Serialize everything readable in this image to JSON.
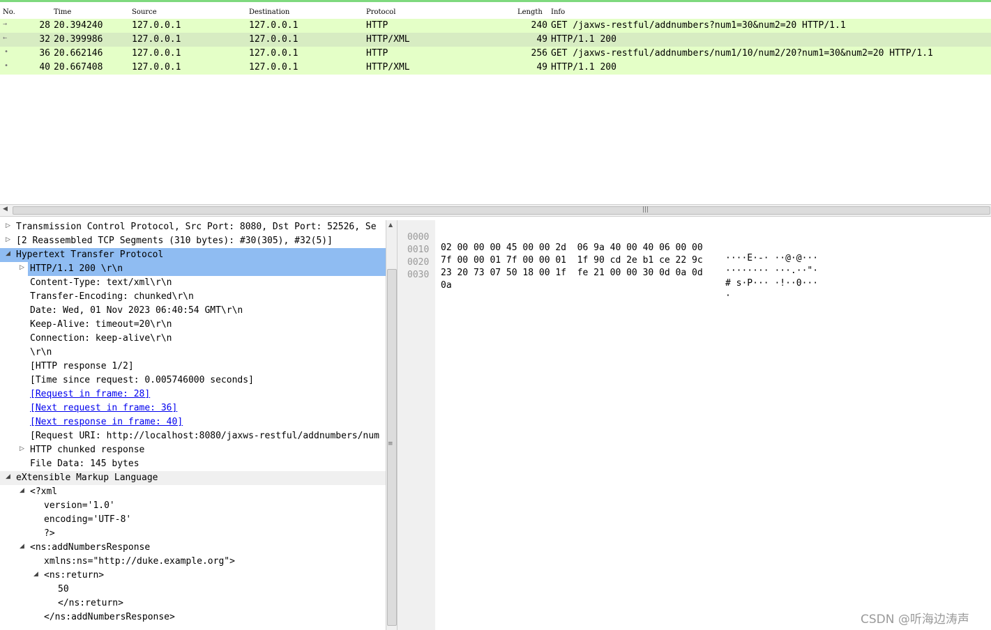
{
  "packet_list": {
    "columns": [
      "No.",
      "Time",
      "Source",
      "Destination",
      "Protocol",
      "Length",
      "Info"
    ],
    "rows": [
      {
        "no": "28",
        "time": "20.394240",
        "source": "127.0.0.1",
        "destination": "127.0.0.1",
        "protocol": "HTTP",
        "length": "240",
        "info": "GET /jaxws-restful/addnumbers?num1=30&num2=20 HTTP/1.1",
        "marker": "→"
      },
      {
        "no": "32",
        "time": "20.399986",
        "source": "127.0.0.1",
        "destination": "127.0.0.1",
        "protocol": "HTTP/XML",
        "length": "49",
        "info": "HTTP/1.1 200",
        "marker": "←"
      },
      {
        "no": "36",
        "time": "20.662146",
        "source": "127.0.0.1",
        "destination": "127.0.0.1",
        "protocol": "HTTP",
        "length": "256",
        "info": "GET /jaxws-restful/addnumbers/num1/10/num2/20?num1=30&num2=20 HTTP/1.1",
        "marker": "•"
      },
      {
        "no": "40",
        "time": "20.667408",
        "source": "127.0.0.1",
        "destination": "127.0.0.1",
        "protocol": "HTTP/XML",
        "length": "49",
        "info": "HTTP/1.1 200",
        "marker": "•"
      }
    ]
  },
  "details": {
    "items": [
      {
        "text": "Transmission Control Protocol, Src Port: 8080, Dst Port: 52526, Se",
        "toggle": "▷"
      },
      {
        "text": "[2 Reassembled TCP Segments (310 bytes): #30(305), #32(5)]",
        "toggle": "▷"
      },
      {
        "text": "Hypertext Transfer Protocol",
        "toggle": "◢"
      },
      {
        "text": "HTTP/1.1 200 \\r\\n",
        "toggle": "▷"
      },
      {
        "text": "Content-Type: text/xml\\r\\n"
      },
      {
        "text": "Transfer-Encoding: chunked\\r\\n"
      },
      {
        "text": "Date: Wed, 01 Nov 2023 06:40:54 GMT\\r\\n"
      },
      {
        "text": "Keep-Alive: timeout=20\\r\\n"
      },
      {
        "text": "Connection: keep-alive\\r\\n"
      },
      {
        "text": "\\r\\n"
      },
      {
        "text": "[HTTP response 1/2]"
      },
      {
        "text": "[Time since request: 0.005746000 seconds]"
      },
      {
        "text": "[Request in frame: 28]"
      },
      {
        "text": "[Next request in frame: 36]"
      },
      {
        "text": "[Next response in frame: 40]"
      },
      {
        "text": "[Request URI: http://localhost:8080/jaxws-restful/addnumbers/num"
      },
      {
        "text": "HTTP chunked response",
        "toggle": "▷"
      },
      {
        "text": "File Data: 145 bytes"
      },
      {
        "text": "eXtensible Markup Language",
        "toggle": "◢"
      },
      {
        "text": "<?xml",
        "toggle": "◢"
      },
      {
        "text": "version='1.0'"
      },
      {
        "text": "encoding='UTF-8'"
      },
      {
        "text": "?>"
      },
      {
        "text": "<ns:addNumbersResponse",
        "toggle": "◢"
      },
      {
        "text": "xmlns:ns=\"http://duke.example.org\">"
      },
      {
        "text": "<ns:return>",
        "toggle": "◢"
      },
      {
        "text": "50"
      },
      {
        "text": "</ns:return>"
      },
      {
        "text": "</ns:addNumbersResponse>"
      }
    ]
  },
  "hex_dump": [
    {
      "offset": "0000",
      "hex": "02 00 00 00 45 00 00 2d  06 9a 40 00 40 06 00 00",
      "ascii": "····E·-· ··@·@···"
    },
    {
      "offset": "0010",
      "hex": "7f 00 00 01 7f 00 00 01  1f 90 cd 2e b1 ce 22 9c",
      "ascii": "········ ···.··\"·"
    },
    {
      "offset": "0020",
      "hex": "23 20 73 07 50 18 00 1f  fe 21 00 00 30 0d 0a 0d",
      "ascii": "# s·P··· ·!··0···"
    },
    {
      "offset": "0030",
      "hex": "0a",
      "ascii": "·"
    }
  ],
  "watermark": "CSDN @听海边涛声",
  "colors": {
    "http_row": "#e4ffc7",
    "selection": "#8fbcf2",
    "link": "#0000ee"
  }
}
